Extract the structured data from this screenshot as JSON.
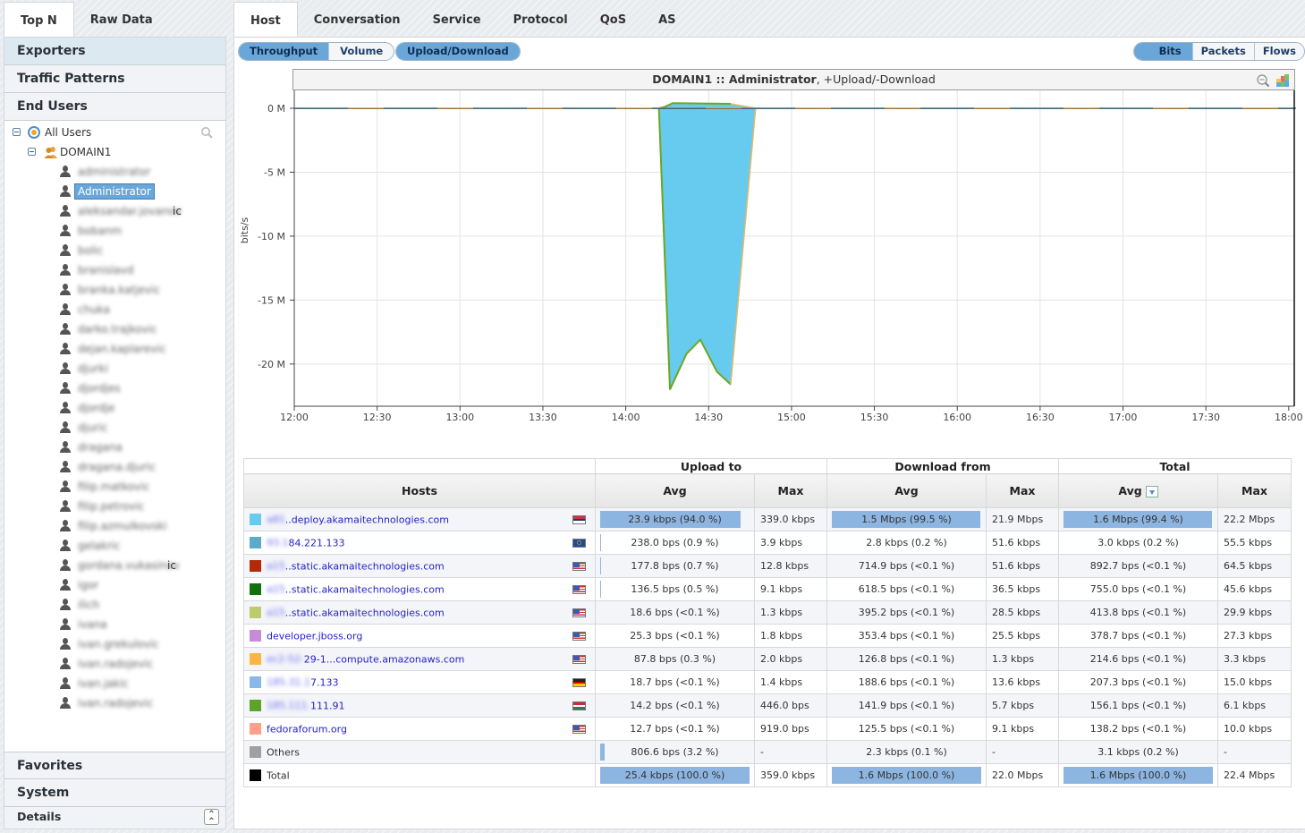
{
  "left_panel": {
    "tabs": [
      {
        "label": "Top N",
        "active": true
      },
      {
        "label": "Raw Data",
        "active": false
      }
    ],
    "sections_top": [
      "Exporters",
      "Traffic Patterns",
      "End Users"
    ],
    "tree": {
      "root_label": "All Users",
      "domain_label": "DOMAIN1",
      "users": [
        {
          "name": "administrator",
          "selected": false,
          "suffix": ""
        },
        {
          "name": "Administrator",
          "selected": true,
          "suffix": ""
        },
        {
          "name": "aleksandar.jovanov",
          "selected": false,
          "suffix": "ic"
        },
        {
          "name": "bobanm",
          "selected": false,
          "suffix": ""
        },
        {
          "name": "bolic",
          "selected": false,
          "suffix": ""
        },
        {
          "name": "branislavd",
          "selected": false,
          "suffix": ""
        },
        {
          "name": "branka.katjevic",
          "selected": false,
          "suffix": ""
        },
        {
          "name": "chuka",
          "selected": false,
          "suffix": ""
        },
        {
          "name": "darko.trajkovic",
          "selected": false,
          "suffix": ""
        },
        {
          "name": "dejan.kaplarevic",
          "selected": false,
          "suffix": ""
        },
        {
          "name": "djurki",
          "selected": false,
          "suffix": ""
        },
        {
          "name": "djordjes",
          "selected": false,
          "suffix": ""
        },
        {
          "name": "djordje",
          "selected": false,
          "suffix": ""
        },
        {
          "name": "djuric",
          "selected": false,
          "suffix": ""
        },
        {
          "name": "dragana",
          "selected": false,
          "suffix": ""
        },
        {
          "name": "dragana.djuric",
          "selected": false,
          "suffix": ""
        },
        {
          "name": "filip.matkovic",
          "selected": false,
          "suffix": ""
        },
        {
          "name": "filip.petrovic",
          "selected": false,
          "suffix": ""
        },
        {
          "name": "filip.azmulkovski",
          "selected": false,
          "suffix": ""
        },
        {
          "name": "gelakric",
          "selected": false,
          "suffix": ""
        },
        {
          "name": "gordana.vukasinov",
          "selected": false,
          "suffix": "ic"
        },
        {
          "name": "igor",
          "selected": false,
          "suffix": ""
        },
        {
          "name": "ilich",
          "selected": false,
          "suffix": ""
        },
        {
          "name": "ivana",
          "selected": false,
          "suffix": ""
        },
        {
          "name": "ivan.grekulovic",
          "selected": false,
          "suffix": ""
        },
        {
          "name": "ivan.radojevic",
          "selected": false,
          "suffix": ""
        },
        {
          "name": "ivan.jakic",
          "selected": false,
          "suffix": ""
        },
        {
          "name": "ivan.radojevic",
          "selected": false,
          "suffix": ""
        }
      ]
    },
    "sections_bottom": [
      "Favorites",
      "System"
    ],
    "details_label": "Details"
  },
  "right_panel": {
    "tabs": [
      {
        "label": "Host",
        "active": true
      },
      {
        "label": "Conversation",
        "active": false
      },
      {
        "label": "Service",
        "active": false
      },
      {
        "label": "Protocol",
        "active": false
      },
      {
        "label": "QoS",
        "active": false
      },
      {
        "label": "AS",
        "active": false
      }
    ],
    "mode_toggle": [
      {
        "label": "Throughput",
        "on": true
      },
      {
        "label": "Volume",
        "on": false
      }
    ],
    "direction_toggle": [
      {
        "label": "Upload/Download",
        "on": true
      }
    ],
    "unit_toggle": [
      {
        "label": "Bits",
        "on": true
      },
      {
        "label": "Packets",
        "on": false
      },
      {
        "label": "Flows",
        "on": false
      }
    ]
  },
  "chart_data": {
    "type": "area",
    "title_bold": "DOMAIN1 :: Administrator",
    "title_rest": ", +Upload/-Download",
    "ylabel": "bits/s",
    "xlabel": "",
    "y_ticks": [
      {
        "value": 0,
        "label": "0 M"
      },
      {
        "value": -5,
        "label": "-5 M"
      },
      {
        "value": -10,
        "label": "-10 M"
      },
      {
        "value": -15,
        "label": "-15 M"
      },
      {
        "value": -20,
        "label": "-20 M"
      }
    ],
    "ylim": [
      -23.3,
      1.4
    ],
    "x_ticks": [
      "12:00",
      "12:30",
      "13:00",
      "13:30",
      "14:00",
      "14:30",
      "15:00",
      "15:30",
      "16:00",
      "16:30",
      "17:00",
      "17:30",
      "18:00"
    ],
    "xlim_minutes": [
      0,
      362
    ],
    "grid": true,
    "series": [
      {
        "name": "download (main host)",
        "color": "#67cbef",
        "stroke": "#6aa820",
        "x_minutes": [
          0,
          132,
          133,
          134,
          136,
          139,
          147,
          152,
          154,
          157,
          160,
          164,
          166,
          168,
          171,
          174,
          362
        ],
        "values_M": [
          0,
          0,
          0.1,
          -0.5,
          -22.0,
          0.3,
          -19.2,
          -18.1,
          0.2,
          -20.6,
          -21.6,
          0.0,
          0,
          0,
          0,
          0,
          0
        ]
      }
    ],
    "envelope_top_M": [
      {
        "x": 132,
        "y": 0.0
      },
      {
        "x": 134,
        "y": 0.1
      },
      {
        "x": 137,
        "y": 0.4
      },
      {
        "x": 158,
        "y": 0.35
      },
      {
        "x": 167,
        "y": 0.0
      }
    ],
    "envelope_bottom_M": [
      {
        "x": 132,
        "y": 0.0
      },
      {
        "x": 136,
        "y": -22.0
      },
      {
        "x": 142,
        "y": -19.2
      },
      {
        "x": 147,
        "y": -18.1
      },
      {
        "x": 153,
        "y": -20.6
      },
      {
        "x": 158,
        "y": -21.6
      },
      {
        "x": 167,
        "y": 0.0
      }
    ]
  },
  "table": {
    "groups": {
      "upload": "Upload to",
      "download": "Download from",
      "total": "Total"
    },
    "headers": {
      "hosts": "Hosts",
      "avg": "Avg",
      "max": "Max"
    },
    "rows": [
      {
        "color": "#67cbef",
        "prefix": "a81",
        "host": "..deploy.akamaitechnologies.com",
        "flag": "rs",
        "link": true,
        "up_avg": "23.9 kbps (94.0 %)",
        "up_pct": 94.0,
        "up_max": "339.0 kbps",
        "dn_avg": "1.5 Mbps (99.5 %)",
        "dn_pct": 99.5,
        "dn_max": "21.9 Mbps",
        "tot_avg": "1.6 Mbps (99.4 %)",
        "tot_pct": 99.4,
        "tot_max": "22.2 Mbps"
      },
      {
        "color": "#5aaccb",
        "prefix": "93.1",
        "host": "84.221.133",
        "flag": "eu",
        "link": true,
        "up_avg": "238.0 bps (0.9 %)",
        "up_pct": 0.9,
        "up_max": "3.9 kbps",
        "dn_avg": "2.8 kbps (0.2 %)",
        "dn_pct": 0.2,
        "dn_max": "51.6 kbps",
        "tot_avg": "3.0 kbps (0.2 %)",
        "tot_pct": 0.2,
        "tot_max": "55.5 kbps"
      },
      {
        "color": "#b32a08",
        "prefix": "a15",
        "host": "..static.akamaitechnologies.com",
        "flag": "us",
        "link": true,
        "up_avg": "177.8 bps (0.7 %)",
        "up_pct": 0.7,
        "up_max": "12.8 kbps",
        "dn_avg": "714.9 bps (<0.1 %)",
        "dn_pct": 0.05,
        "dn_max": "51.6 kbps",
        "tot_avg": "892.7 bps (<0.1 %)",
        "tot_pct": 0.05,
        "tot_max": "64.5 kbps"
      },
      {
        "color": "#12700f",
        "prefix": "a15",
        "host": "..static.akamaitechnologies.com",
        "flag": "us",
        "link": true,
        "up_avg": "136.5 bps (0.5 %)",
        "up_pct": 0.5,
        "up_max": "9.1 kbps",
        "dn_avg": "618.5 bps (<0.1 %)",
        "dn_pct": 0.05,
        "dn_max": "36.5 kbps",
        "tot_avg": "755.0 bps (<0.1 %)",
        "tot_pct": 0.05,
        "tot_max": "45.6 kbps"
      },
      {
        "color": "#bccb6b",
        "prefix": "a15",
        "host": "..static.akamaitechnologies.com",
        "flag": "us",
        "link": true,
        "up_avg": "18.6 bps (<0.1 %)",
        "up_pct": 0.05,
        "up_max": "1.3 kbps",
        "dn_avg": "395.2 bps (<0.1 %)",
        "dn_pct": 0.05,
        "dn_max": "28.5 kbps",
        "tot_avg": "413.8 bps (<0.1 %)",
        "tot_pct": 0.05,
        "tot_max": "29.9 kbps"
      },
      {
        "color": "#c98ad8",
        "prefix": "",
        "host": "developer.jboss.org",
        "flag": "us",
        "link": true,
        "up_avg": "25.3 bps (<0.1 %)",
        "up_pct": 0.05,
        "up_max": "1.8 kbps",
        "dn_avg": "353.4 bps (<0.1 %)",
        "dn_pct": 0.05,
        "dn_max": "25.5 kbps",
        "tot_avg": "378.7 bps (<0.1 %)",
        "tot_pct": 0.05,
        "tot_max": "27.3 kbps"
      },
      {
        "color": "#ffb546",
        "prefix": "ec2-52-",
        "host": "29-1...compute.amazonaws.com",
        "flag": "us",
        "link": true,
        "up_avg": "87.8 bps (0.3 %)",
        "up_pct": 0.3,
        "up_max": "2.0 kbps",
        "dn_avg": "126.8 bps (<0.1 %)",
        "dn_pct": 0.05,
        "dn_max": "1.3 kbps",
        "tot_avg": "214.6 bps (<0.1 %)",
        "tot_pct": 0.05,
        "tot_max": "3.3 kbps"
      },
      {
        "color": "#8ab8e8",
        "prefix": "185.31.1",
        "host": "7.133",
        "flag": "de",
        "link": true,
        "up_avg": "18.7 bps (<0.1 %)",
        "up_pct": 0.05,
        "up_max": "1.4 kbps",
        "dn_avg": "188.6 bps (<0.1 %)",
        "dn_pct": 0.05,
        "dn_max": "13.6 kbps",
        "tot_avg": "207.3 bps (<0.1 %)",
        "tot_pct": 0.05,
        "tot_max": "15.0 kbps"
      },
      {
        "color": "#5aa42a",
        "prefix": "185.111.",
        "host": "111.91",
        "flag": "hu",
        "link": true,
        "up_avg": "14.2 bps (<0.1 %)",
        "up_pct": 0.05,
        "up_max": "446.0 bps",
        "dn_avg": "141.9 bps (<0.1 %)",
        "dn_pct": 0.05,
        "dn_max": "5.7 kbps",
        "tot_avg": "156.1 bps (<0.1 %)",
        "tot_pct": 0.05,
        "tot_max": "6.1 kbps"
      },
      {
        "color": "#ff9f8c",
        "prefix": "",
        "host": "fedoraforum.org",
        "flag": "us",
        "link": true,
        "up_avg": "12.7 bps (<0.1 %)",
        "up_pct": 0.05,
        "up_max": "919.0 bps",
        "dn_avg": "125.5 bps (<0.1 %)",
        "dn_pct": 0.05,
        "dn_max": "9.1 kbps",
        "tot_avg": "138.2 bps (<0.1 %)",
        "tot_pct": 0.05,
        "tot_max": "10.0 kbps"
      },
      {
        "color": "#a0a0a0",
        "prefix": "",
        "host": "Others",
        "flag": "",
        "link": false,
        "up_avg": "806.6 bps (3.2 %)",
        "up_pct": 3.2,
        "up_max": "-",
        "dn_avg": "2.3 kbps (0.1 %)",
        "dn_pct": 0.1,
        "dn_max": "-",
        "tot_avg": "3.1 kbps (0.2 %)",
        "tot_pct": 0.2,
        "tot_max": "-"
      },
      {
        "color": "#000000",
        "prefix": "",
        "host": "Total",
        "flag": "",
        "link": false,
        "up_avg": "25.4 kbps (100.0 %)",
        "up_pct": 100.0,
        "up_max": "359.0 kbps",
        "dn_avg": "1.6 Mbps (100.0 %)",
        "dn_pct": 100.0,
        "dn_max": "22.0 Mbps",
        "tot_avg": "1.6 Mbps (100.0 %)",
        "tot_pct": 100.0,
        "tot_max": "22.4 Mbps"
      }
    ]
  }
}
